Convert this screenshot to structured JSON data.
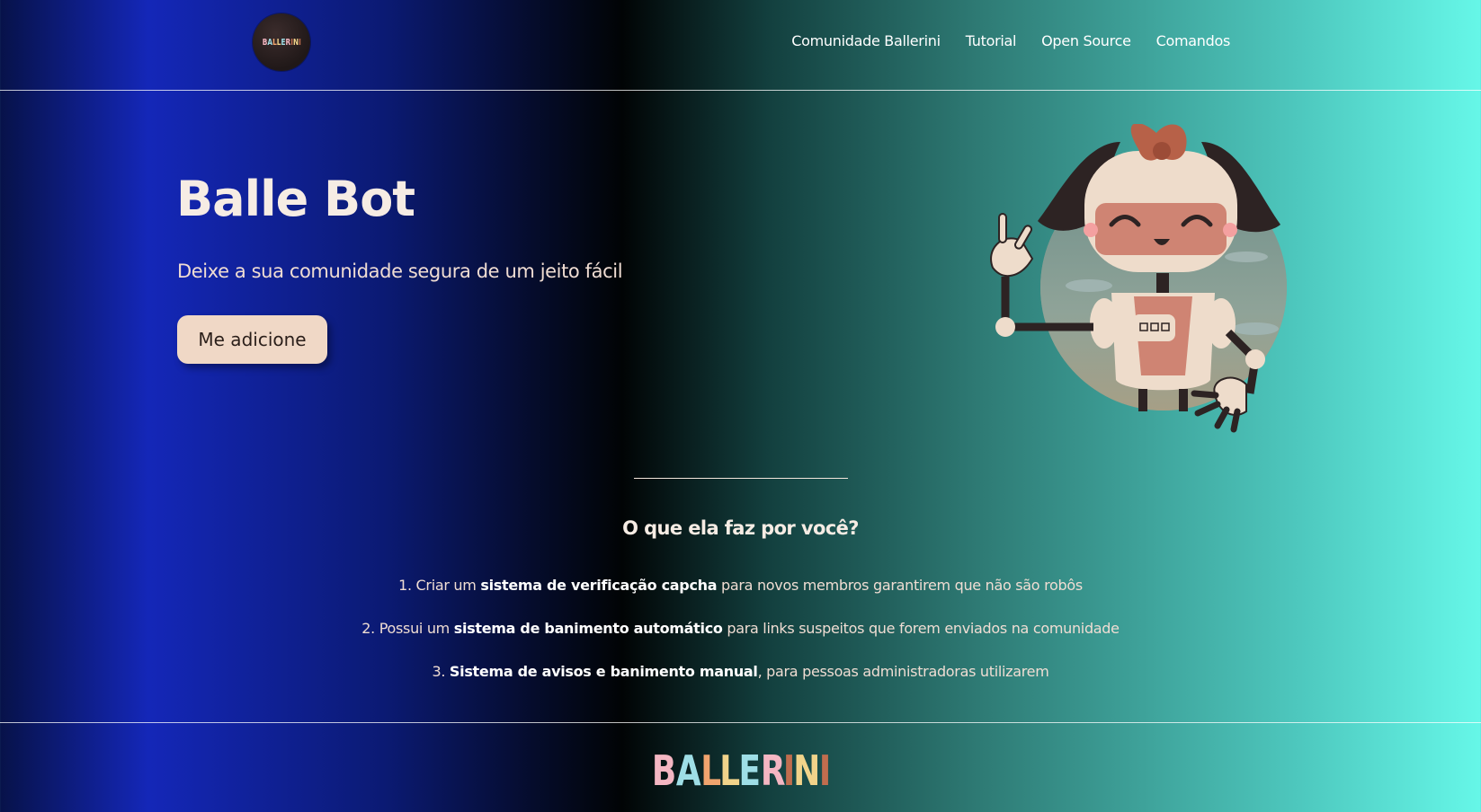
{
  "header": {
    "logo_text": "BALLERINI",
    "nav": [
      {
        "label": "Comunidade Ballerini"
      },
      {
        "label": "Tutorial"
      },
      {
        "label": "Open Source"
      },
      {
        "label": "Comandos"
      }
    ]
  },
  "hero": {
    "title": "Balle Bot",
    "subtitle": "Deixe a sua comunidade segura de um jeito fácil",
    "button_label": "Me adicione"
  },
  "features": {
    "title": "O que ela faz por você?",
    "items": [
      {
        "prefix": "1. Criar um ",
        "bold": "sistema de verificação capcha",
        "suffix": " para novos membros garantirem que não são robôs"
      },
      {
        "prefix": "2. Possui um ",
        "bold": "sistema de banimento automático",
        "suffix": " para links suspeitos que forem enviados na comunidade"
      },
      {
        "prefix": "3. ",
        "bold": "Sistema de avisos e banimento manual",
        "suffix": ", para pessoas administradoras utilizarem"
      }
    ]
  },
  "footer": {
    "logo_text": "BALLERINI",
    "letter_colors": [
      "#f4b6c2",
      "#9edee6",
      "#f0a46e",
      "#f1d38a",
      "#9edee6",
      "#f4b6c2",
      "#c06d4e",
      "#f1d38a",
      "#c06d4e"
    ]
  },
  "colors": {
    "accent_button": "#f0d8c6",
    "text_light": "#f0ddd3"
  }
}
